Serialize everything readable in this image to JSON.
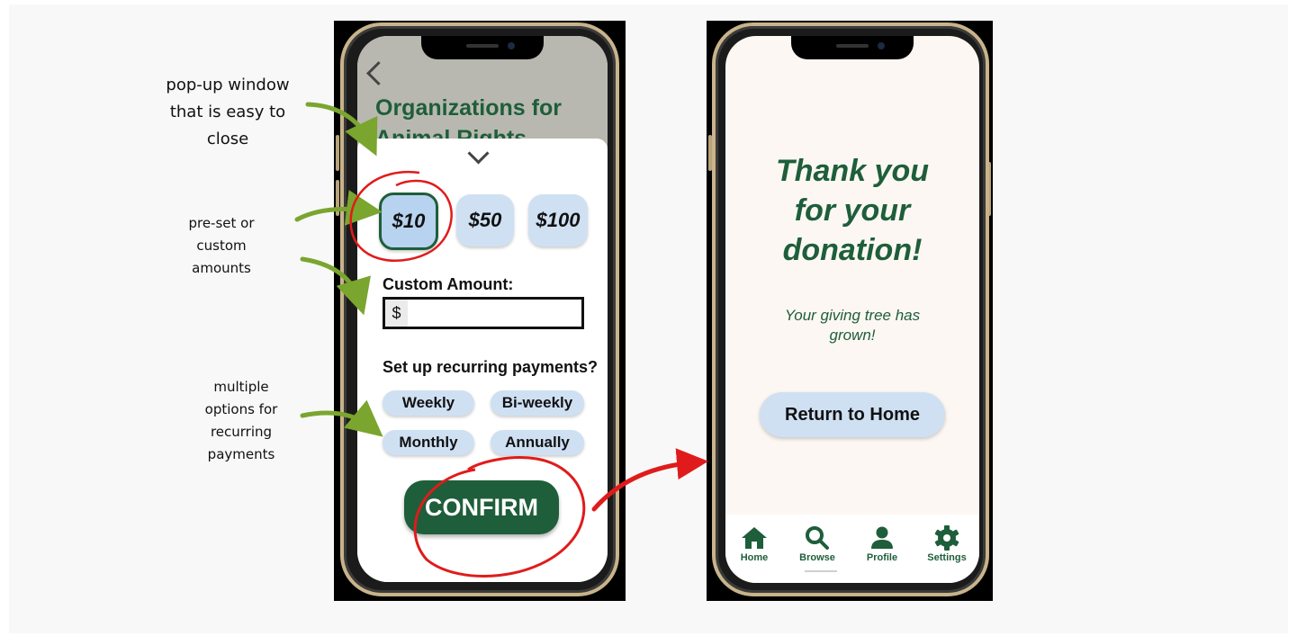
{
  "annotations": {
    "popup": [
      "pop-up window",
      "that is easy to",
      "close"
    ],
    "amounts": [
      "pre-set or",
      "custom",
      "amounts"
    ],
    "recurring": [
      "multiple",
      "options for",
      "recurring",
      "payments"
    ]
  },
  "donation_screen": {
    "title": "Organizations for",
    "title_cut": "Animal Rights",
    "amounts": [
      "$10",
      "$50",
      "$100"
    ],
    "selected_amount": "$10",
    "custom_label": "Custom Amount:",
    "currency_symbol": "$",
    "custom_value": "",
    "recurring_label": "Set up recurring payments?",
    "recurring_options": [
      "Weekly",
      "Bi-weekly",
      "Monthly",
      "Annually"
    ],
    "confirm_label": "CONFIRM"
  },
  "thanks_screen": {
    "heading_lines": [
      "Thank you",
      "for your",
      "donation!"
    ],
    "subtext_lines": [
      "Your giving tree has",
      "grown!"
    ],
    "return_label": "Return to Home",
    "nav": [
      "Home",
      "Browse",
      "Profile",
      "Settings"
    ],
    "active_nav": "Browse"
  },
  "colors": {
    "brand_green": "#1e5e3a",
    "button_blue": "#cfe0f3",
    "annotation_arrow": "#7aa52f",
    "highlight_red": "#e01b1b",
    "screen_cream": "#fcf7f3"
  },
  "icons": [
    "back-arrow-icon",
    "chevron-down-icon",
    "home-icon",
    "search-icon",
    "person-icon",
    "gear-icon"
  ]
}
